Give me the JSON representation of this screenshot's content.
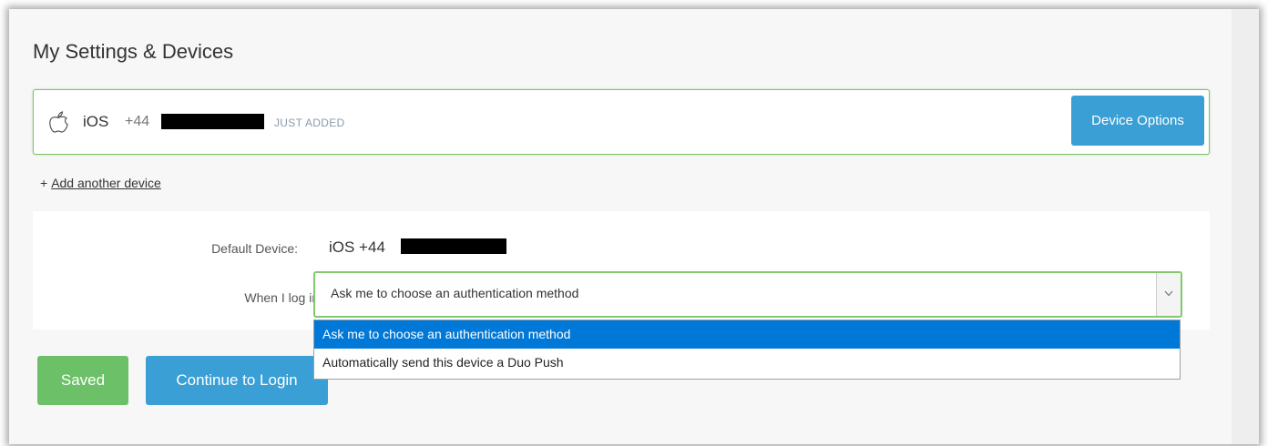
{
  "page": {
    "title": "My Settings & Devices"
  },
  "device": {
    "icon": "apple-icon",
    "os": "iOS",
    "phone_prefix": "+44",
    "status": "JUST ADDED",
    "options_label": "Device Options"
  },
  "add_device": {
    "plus": "+",
    "label": "Add another device"
  },
  "settings": {
    "default_device_label": "Default Device:",
    "default_device_value": "iOS +44",
    "login_label": "When I log in:",
    "login_selected": "Ask me to choose an authentication method",
    "login_options": [
      "Ask me to choose an authentication method",
      "Automatically send this device a Duo Push"
    ]
  },
  "actions": {
    "saved_label": "Saved",
    "continue_label": "Continue to Login"
  },
  "colors": {
    "accent_blue": "#3a9fd5",
    "success_green": "#6cc067",
    "card_border_green": "#7dc56a",
    "selection_blue": "#0078d7"
  }
}
